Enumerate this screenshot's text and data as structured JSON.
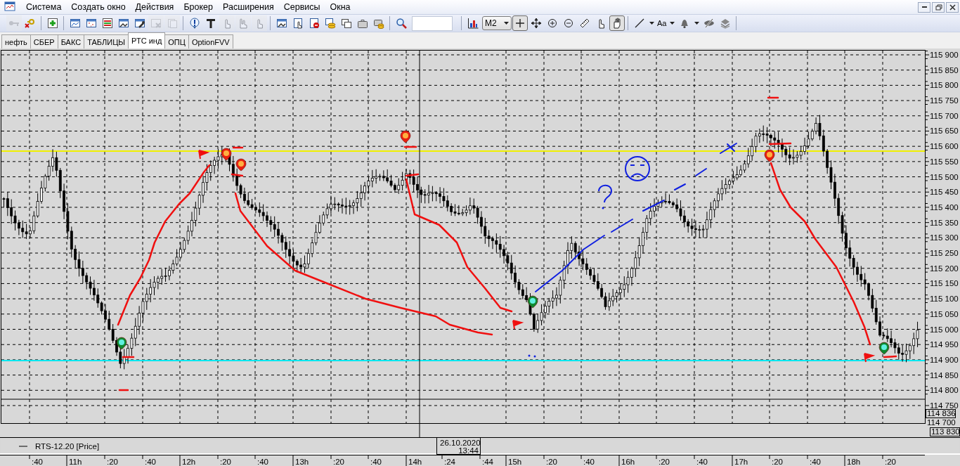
{
  "menu": [
    "Система",
    "Создать окно",
    "Действия",
    "Брокер",
    "Расширения",
    "Сервисы",
    "Окна"
  ],
  "window_controls": [
    {
      "kind": "minimize"
    },
    {
      "kind": "restore"
    },
    {
      "kind": "close"
    }
  ],
  "toolbar": [
    {
      "kind": "key",
      "disabled": true
    },
    {
      "kind": "key-delete",
      "disabled": false
    },
    {
      "kind": "sep"
    },
    {
      "kind": "plus",
      "disabled": false
    },
    {
      "kind": "sep"
    },
    {
      "kind": "chart-window",
      "disabled": false
    },
    {
      "kind": "window",
      "disabled": false
    },
    {
      "kind": "list",
      "disabled": false
    },
    {
      "kind": "window-hands",
      "disabled": false
    },
    {
      "kind": "window-wrench",
      "disabled": false
    },
    {
      "kind": "window-cross",
      "disabled": true
    },
    {
      "kind": "pages",
      "disabled": true
    },
    {
      "kind": "sep"
    },
    {
      "kind": "exclamation",
      "disabled": false
    },
    {
      "kind": "letter-t",
      "disabled": false
    },
    {
      "kind": "finger",
      "disabled": true
    },
    {
      "kind": "fingers",
      "disabled": true
    },
    {
      "kind": "finger",
      "disabled": true
    },
    {
      "kind": "sep"
    },
    {
      "kind": "window-hands",
      "disabled": false
    },
    {
      "kind": "doc-hand",
      "disabled": false
    },
    {
      "kind": "doc-stop",
      "disabled": false
    },
    {
      "kind": "coins",
      "disabled": false
    },
    {
      "kind": "windows",
      "disabled": false
    },
    {
      "kind": "briefcase",
      "disabled": false
    },
    {
      "kind": "briefcase-coins",
      "disabled": false
    },
    {
      "kind": "sep"
    },
    {
      "kind": "search",
      "disabled": false
    },
    {
      "kind": "field"
    },
    {
      "kind": "sep"
    },
    {
      "kind": "bar-chart",
      "disabled": false
    },
    {
      "kind": "combo",
      "value": "M2"
    },
    {
      "kind": "crosshair",
      "selected": true
    },
    {
      "kind": "move",
      "disabled": false
    },
    {
      "kind": "zoom-in",
      "disabled": false
    },
    {
      "kind": "zoom-out",
      "disabled": false
    },
    {
      "kind": "ruler",
      "disabled": false
    },
    {
      "kind": "finger",
      "disabled": false
    },
    {
      "kind": "hand",
      "selected": true
    },
    {
      "kind": "sep"
    },
    {
      "kind": "line",
      "disabled": false
    },
    {
      "kind": "caret"
    },
    {
      "kind": "text",
      "label": "Aa"
    },
    {
      "kind": "caret"
    },
    {
      "kind": "bell",
      "disabled": false
    },
    {
      "kind": "caret"
    },
    {
      "kind": "eye-slash",
      "disabled": false
    },
    {
      "kind": "layers",
      "disabled": false
    },
    {
      "kind": "sep"
    }
  ],
  "tabs": [
    {
      "label": "нефть",
      "selected": false
    },
    {
      "label": "СБЕР",
      "selected": false
    },
    {
      "label": "БАКС",
      "selected": false
    },
    {
      "label": "ТАБЛИЦЫ",
      "selected": false
    },
    {
      "label": "РТС инд",
      "selected": true
    },
    {
      "label": "ОПЦ",
      "selected": false
    },
    {
      "label": "OptionFVV",
      "selected": false
    }
  ],
  "chart": {
    "price_axis": [
      "115 900",
      "115 850",
      "115 800",
      "115 750",
      "115 700",
      "115 650",
      "115 600",
      "115 550",
      "115 500",
      "115 450",
      "115 400",
      "115 350",
      "115 300",
      "115 250",
      "115 200",
      "115 150",
      "115 100",
      "115 050",
      "115 000",
      "114 950",
      "114 900",
      "114 850",
      "114 800",
      "114 750"
    ],
    "price_markers": [
      {
        "label": "114 836",
        "boxed": true
      },
      {
        "label": "114 700",
        "boxed": false
      },
      {
        "label": "113 830",
        "boxed": true
      }
    ],
    "level_lines": [
      {
        "color": "#f0f000"
      },
      {
        "color": "#00e8f0"
      }
    ],
    "legend": "RTS-12.20 [Price]",
    "cursor": {
      "date": "26.10.2020",
      "time": "13:44"
    },
    "time_axis": [
      ":40",
      "11h",
      ":20",
      ":40",
      "12h",
      ":20",
      ":40",
      "13h",
      ":20",
      ":40",
      "14h",
      ":24",
      ":44",
      "15h",
      ":20",
      ":40",
      "16h",
      ":20",
      ":40",
      "17h",
      ":20",
      ":40",
      "18h",
      ":20"
    ]
  }
}
